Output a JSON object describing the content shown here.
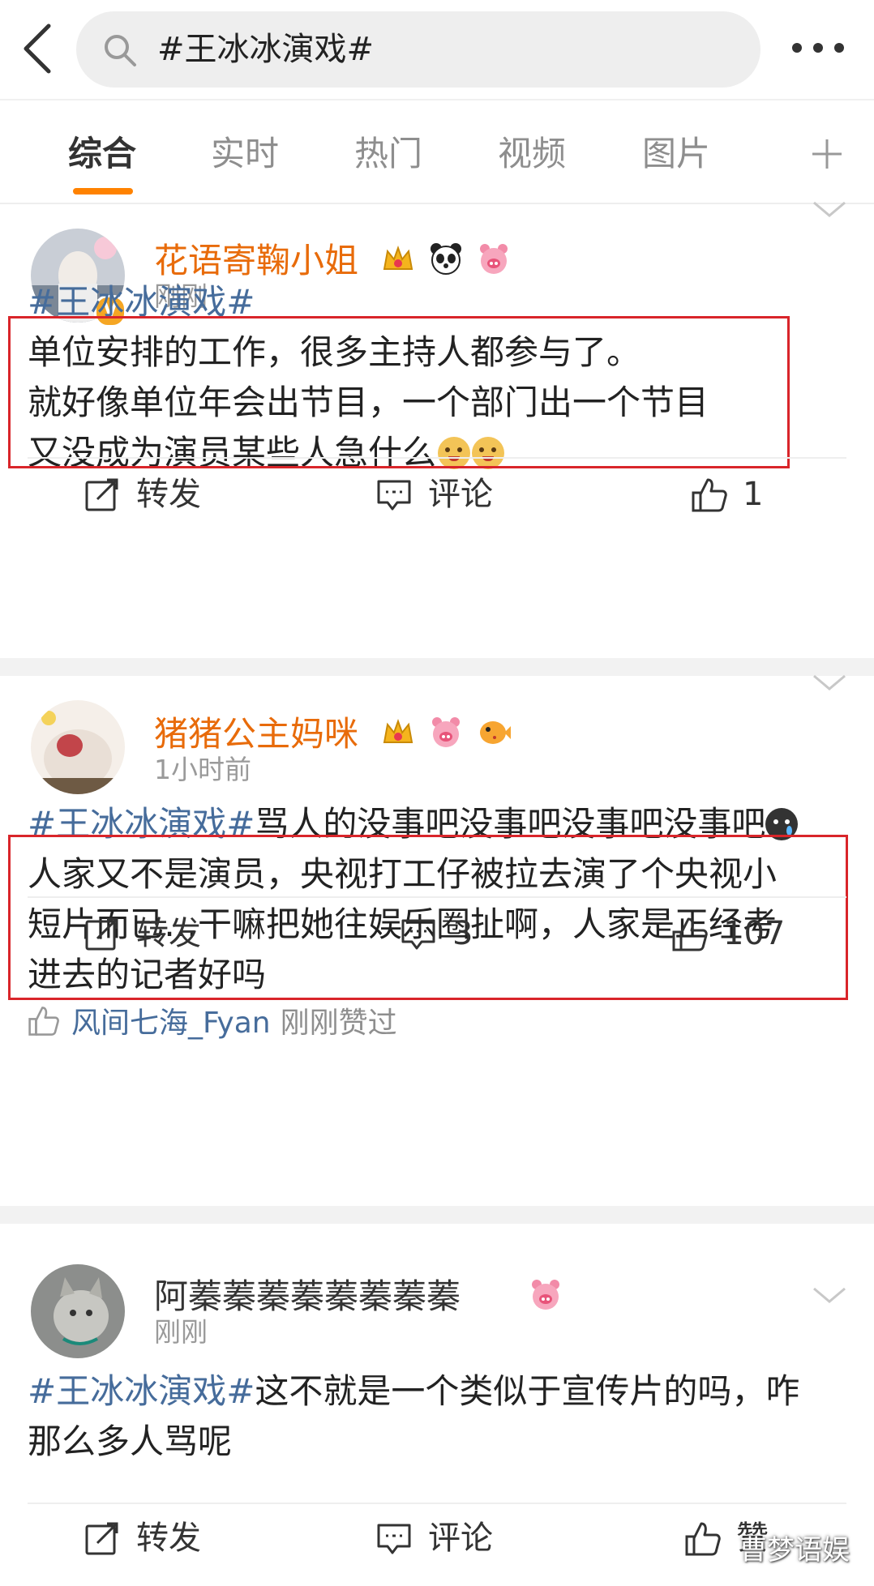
{
  "search": {
    "query": "#王冰冰演戏#"
  },
  "tabs": [
    {
      "label": "综合",
      "active": true
    },
    {
      "label": "实时"
    },
    {
      "label": "热门"
    },
    {
      "label": "视频"
    },
    {
      "label": "图片"
    }
  ],
  "colors": {
    "accent": "#ff8200",
    "tag": "#466c9b",
    "username_vip": "#e86b0a",
    "highlight_box": "#d9252a"
  },
  "posts": [
    {
      "username": "花语寄鞠小姐",
      "time": "刚刚",
      "verified": true,
      "badges": [
        "crown-icon",
        "panda-icon",
        "pig-icon"
      ],
      "tag": "#王冰冰演戏#",
      "lines": [
        "单位安排的工作，很多主持人都参与了。",
        "就好像单位年会出节目，一个部门出一个节目",
        "又没成为演员某些人急什么"
      ],
      "actions": {
        "repost": "转发",
        "comment": "评论",
        "like": "1"
      }
    },
    {
      "username": "猪猪公主妈咪",
      "time": "1小时前",
      "badges": [
        "crown-icon",
        "pig-icon",
        "pufferfish-icon"
      ],
      "tag": "#王冰冰演戏#",
      "line1_rest": "骂人的没事吧没事吧没事吧没事吧",
      "lines": [
        "人家又不是演员，央视打工仔被拉去演了个央视小",
        "短片而已…干嘛把她往娱乐圈扯啊，人家是正经考",
        "进去的记者好吗"
      ],
      "liker": {
        "name": "风间七海_Fyan",
        "text": "刚刚赞过"
      },
      "actions": {
        "repost": "转发",
        "comment": "3",
        "like": "107"
      }
    },
    {
      "username": "阿蓁蓁蓁蓁蓁蓁蓁蓁",
      "time": "刚刚",
      "badges": [
        "pig-icon"
      ],
      "tag": "#王冰冰演戏#",
      "line1_rest": "这不就是一个类似于宣传片的吗，咋",
      "lines": [
        "那么多人骂呢"
      ],
      "actions": {
        "repost": "转发",
        "comment": "评论",
        "like": "赞"
      }
    }
  ],
  "watermark": "曹梦语娱"
}
